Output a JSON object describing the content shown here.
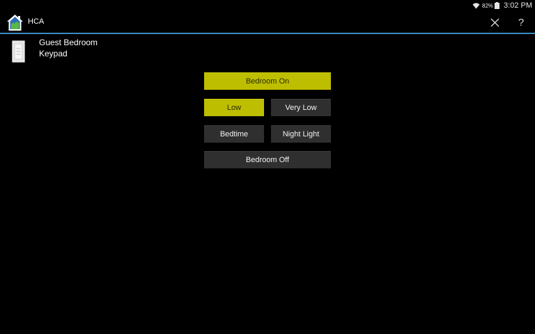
{
  "status_bar": {
    "battery_percent": "82%",
    "time": "3:02 PM",
    "icons": [
      "wifi-icon",
      "battery-icon"
    ]
  },
  "app": {
    "title": "HCA",
    "icon": "house-icon"
  },
  "actions": {
    "close_icon": "close-icon",
    "help_label": "?"
  },
  "device": {
    "name_line1": "Guest Bedroom",
    "name_line2": "Keypad",
    "icon": "keypad-switch-icon"
  },
  "buttons": {
    "bedroom_on": {
      "label": "Bedroom On",
      "active": true
    },
    "low": {
      "label": "Low",
      "active": true
    },
    "very_low": {
      "label": "Very Low",
      "active": false
    },
    "bedtime": {
      "label": "Bedtime",
      "active": false
    },
    "night_light": {
      "label": "Night Light",
      "active": false
    },
    "bedroom_off": {
      "label": "Bedroom Off",
      "active": false
    }
  },
  "colors": {
    "active_button": "#bebe00",
    "inactive_button": "#2f2f2f",
    "divider": "#3a8cc4",
    "background": "#000000"
  }
}
